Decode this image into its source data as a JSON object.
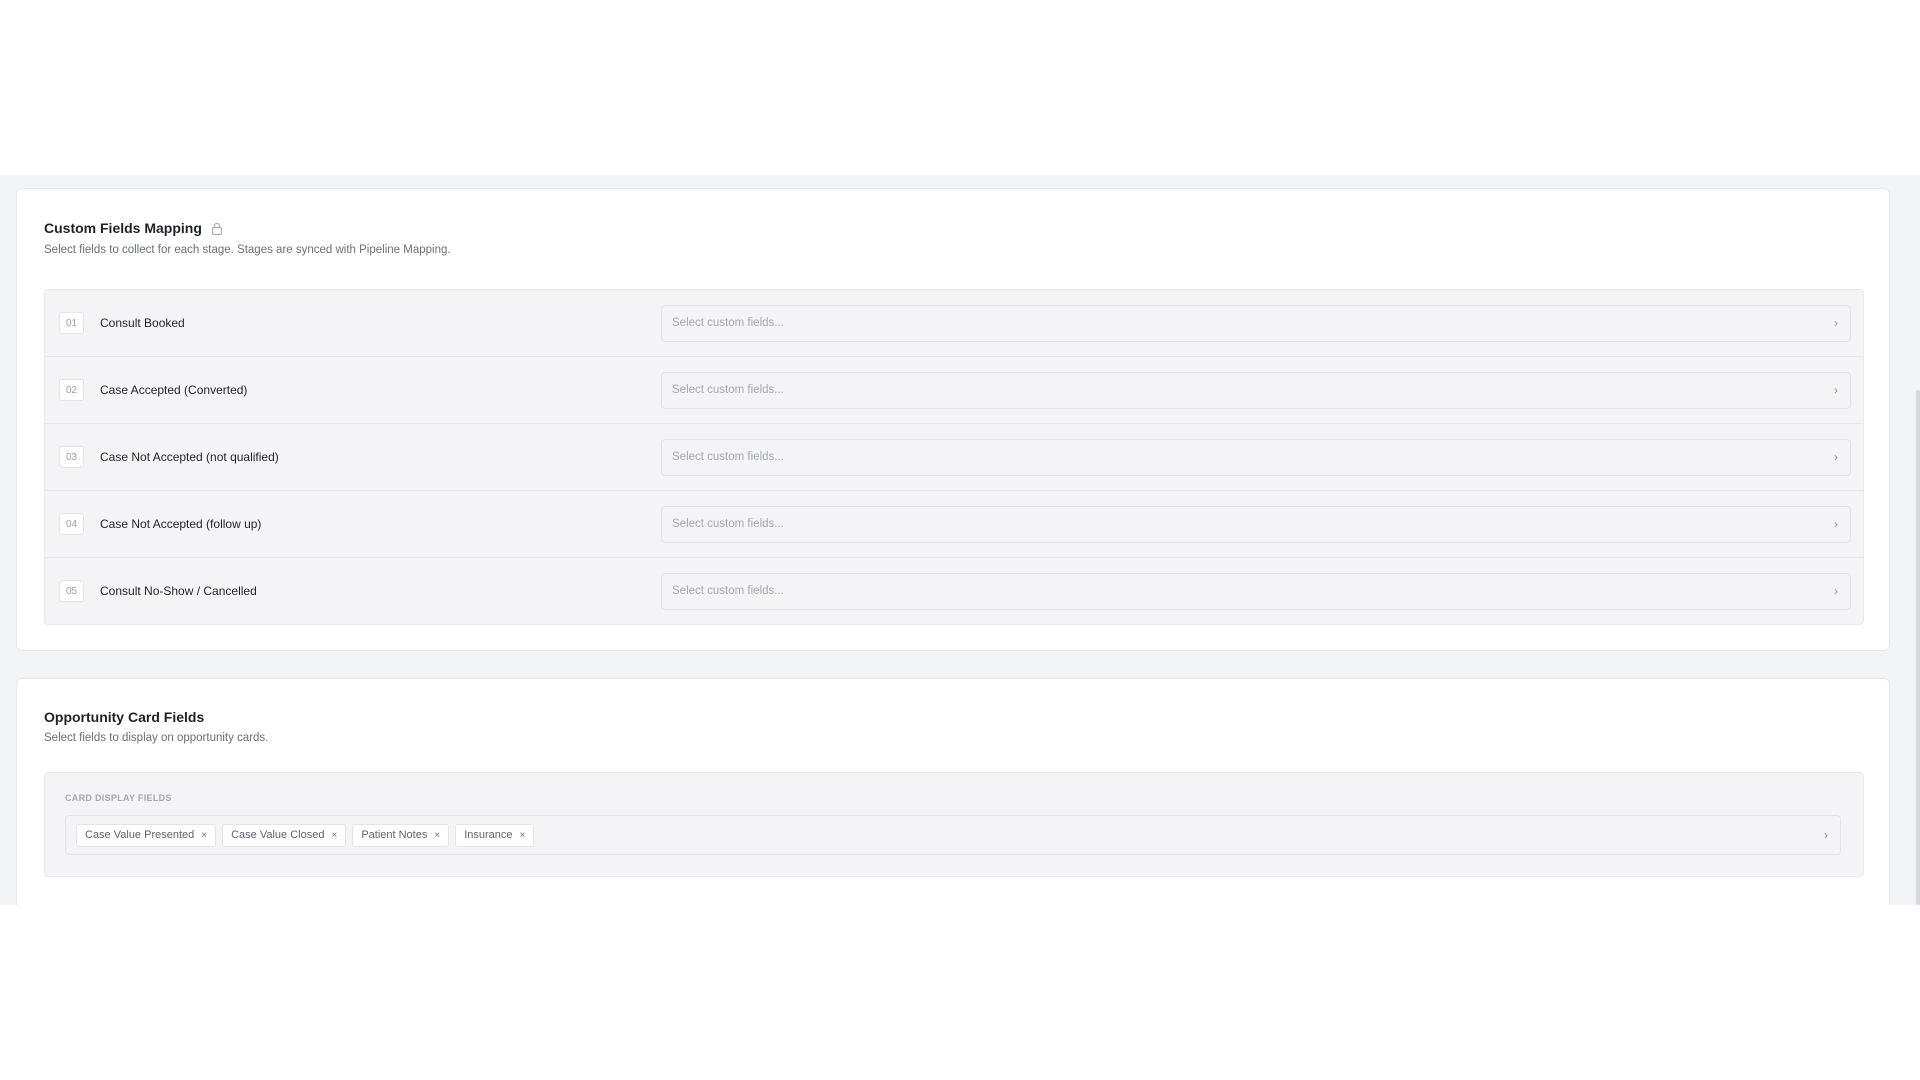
{
  "mapping": {
    "title": "Custom Fields Mapping",
    "lock_icon": "lock-icon",
    "subtitle": "Select fields to collect for each stage. Stages are synced with Pipeline Mapping.",
    "stages": [
      {
        "num": "01",
        "name": "Consult Booked",
        "placeholder": "Select custom fields..."
      },
      {
        "num": "02",
        "name": "Case Accepted (Converted)",
        "placeholder": "Select custom fields..."
      },
      {
        "num": "03",
        "name": "Case Not Accepted (not qualified)",
        "placeholder": "Select custom fields..."
      },
      {
        "num": "04",
        "name": "Case Not Accepted (follow up)",
        "placeholder": "Select custom fields..."
      },
      {
        "num": "05",
        "name": "Consult No-Show / Cancelled",
        "placeholder": "Select custom fields..."
      }
    ],
    "chevron": "›"
  },
  "opportunity": {
    "title": "Opportunity Card Fields",
    "subtitle": "Select fields to display on opportunity cards.",
    "label": "CARD DISPLAY FIELDS",
    "tags": [
      "Case Value Presented",
      "Case Value Closed",
      "Patient Notes",
      "Insurance"
    ],
    "remove_glyph": "×",
    "chevron": "›"
  }
}
